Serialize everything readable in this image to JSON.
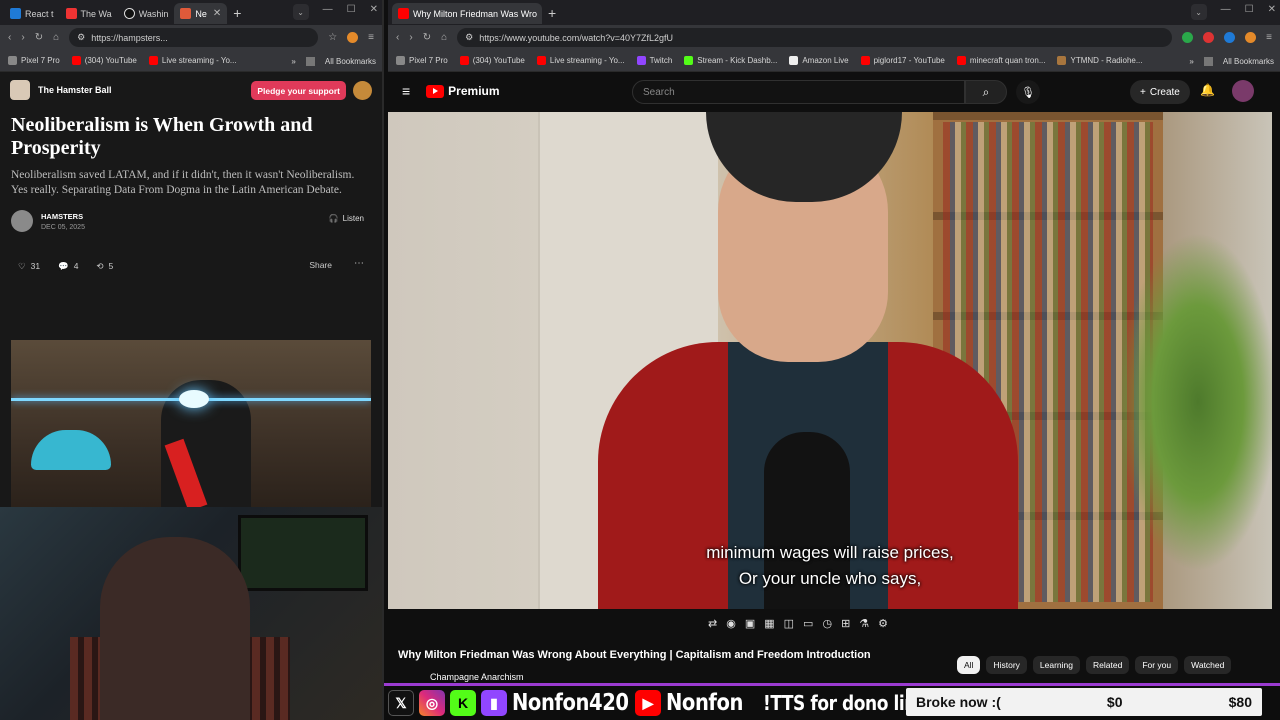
{
  "left_browser": {
    "tabs": [
      {
        "label": "React t",
        "color": "#1f7ad6"
      },
      {
        "label": "The Wa",
        "color": "#e33"
      },
      {
        "label": "Washin",
        "color": "#eee"
      },
      {
        "label": "Ne",
        "color": "#e05a3a",
        "active": true
      }
    ],
    "url": "https://hampsters...",
    "bookmarks": [
      "Pixel 7 Pro",
      "(304) YouTube",
      "Live streaming - Yo..."
    ],
    "all_bookmarks": "All Bookmarks"
  },
  "article": {
    "publication": "The Hamster Ball",
    "pledge": "Pledge your support",
    "title": "Neoliberalism is When Growth and Prosperity",
    "subtitle": "Neoliberalism saved LATAM, and if it didn't, then it wasn't Neoliberalism. Yes really. Separating Data From Dogma in the Latin American Debate.",
    "author": "HAMSTERS",
    "date": "DEC 05, 2025",
    "listen": "Listen",
    "likes": "31",
    "comments": "4",
    "restacks": "5",
    "share": "Share"
  },
  "right_browser": {
    "tab_title": "Why Milton Friedman Was Wro",
    "url": "https://www.youtube.com/watch?v=40Y7ZfL2gfU",
    "bookmarks": [
      "Pixel 7 Pro",
      "(304) YouTube",
      "Live streaming - Yo...",
      "Twitch",
      "Stream - Kick Dashb...",
      "Amazon Live",
      "piglord17 - YouTube",
      "minecraft quan tron...",
      "YTMND - Radiohe..."
    ],
    "all_bookmarks": "All Bookmarks"
  },
  "youtube": {
    "brand": "Premium",
    "search_placeholder": "Search",
    "create": "Create",
    "subtitle_line1": "minimum wages will raise prices,",
    "subtitle_line2": "Or your uncle who says,",
    "video_title": "Why Milton Friedman Was Wrong About Everything | Capitalism and Freedom Introduction",
    "channel": "Champagne Anarchism",
    "chips": [
      "All",
      "History",
      "Learning",
      "Related",
      "For you",
      "Watched"
    ]
  },
  "overlay": {
    "handle1": "Nonfon420",
    "handle2": "Nonfon",
    "tts": "!TTS for dono link",
    "goal_label": "Broke now :(",
    "goal_current": "$0",
    "goal_target": "$80",
    "colors": {
      "accent": "#9b3bd1",
      "youtube": "#ff0000",
      "kick": "#53fc18",
      "twitch": "#9146ff"
    }
  }
}
